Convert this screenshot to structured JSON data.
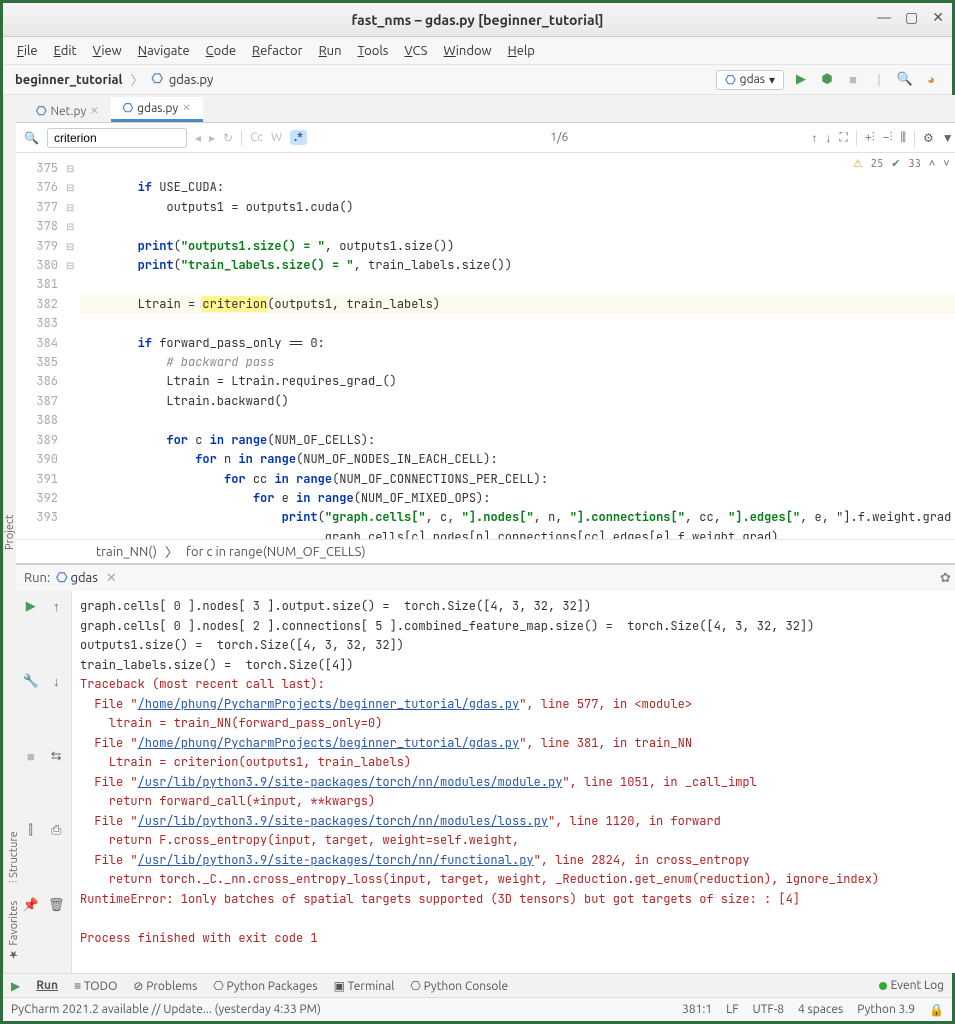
{
  "window": {
    "title": "fast_nms – gdas.py [beginner_tutorial]"
  },
  "menu": [
    "File",
    "Edit",
    "View",
    "Navigate",
    "Code",
    "Refactor",
    "Run",
    "Tools",
    "VCS",
    "Window",
    "Help"
  ],
  "nav": {
    "project": "beginner_tutorial",
    "file": "gdas.py",
    "run_config": "gdas"
  },
  "tabs": [
    {
      "label": "Net.py",
      "active": false
    },
    {
      "label": "gdas.py",
      "active": true
    }
  ],
  "find": {
    "query": "criterion",
    "count": "1/6"
  },
  "inspection": {
    "warnings": "25",
    "oks": "33"
  },
  "gutter_start": 375,
  "gutter_labels": [
    "",
    "375",
    "376",
    "377",
    "378",
    "379",
    "380",
    "381",
    "382",
    "383",
    "384",
    "385",
    "386",
    "387",
    "388",
    "389",
    "390",
    "391",
    "392",
    "393"
  ],
  "code_lines": [
    "",
    "        if USE_CUDA:",
    "            outputs1 = outputs1.cuda()",
    "",
    "        print(\"outputs1.size() = \", outputs1.size())",
    "        print(\"train_labels.size() = \", train_labels.size())",
    "",
    "        Ltrain = criterion(outputs1, train_labels)",
    "",
    "        if forward_pass_only == 0:",
    "            # backward pass",
    "            Ltrain = Ltrain.requires_grad_()",
    "            Ltrain.backward()",
    "",
    "            for c in range(NUM_OF_CELLS):",
    "                for n in range(NUM_OF_NODES_IN_EACH_CELL):",
    "                    for cc in range(NUM_OF_CONNECTIONS_PER_CELL):",
    "                        for e in range(NUM_OF_MIXED_OPS):",
    "                            print(\"graph.cells[\", c, \"].nodes[\", n, \"].connections[\", cc, \"].edges[\", e, \"].f.weight.grad =",
    "                                  graph.cells[c].nodes[n].connections[cc].edges[e].f.weight.grad)"
  ],
  "code_crumb": {
    "a": "train_NN()",
    "b": "for c in range(NUM_OF_CELLS)"
  },
  "run": {
    "title": "gdas"
  },
  "console_lines": [
    {
      "t": "graph.cells[ 0 ].nodes[ 3 ].output.size() =  torch.Size([4, 3, 32, 32])"
    },
    {
      "t": "graph.cells[ 0 ].nodes[ 2 ].connections[ 5 ].combined_feature_map.size() =  torch.Size([4, 3, 32, 32])"
    },
    {
      "t": "outputs1.size() =  torch.Size([4, 3, 32, 32])"
    },
    {
      "t": "train_labels.size() =  torch.Size([4])"
    },
    {
      "err": true,
      "t": "Traceback (most recent call last):"
    },
    {
      "err": true,
      "pre": "  File \"",
      "link": "/home/phung/PycharmProjects/beginner_tutorial/gdas.py",
      "post": "\", line 577, in <module>"
    },
    {
      "err": true,
      "t": "    ltrain = train_NN(forward_pass_only=0)"
    },
    {
      "err": true,
      "pre": "  File \"",
      "link": "/home/phung/PycharmProjects/beginner_tutorial/gdas.py",
      "post": "\", line 381, in train_NN"
    },
    {
      "err": true,
      "t": "    Ltrain = criterion(outputs1, train_labels)"
    },
    {
      "err": true,
      "pre": "  File \"",
      "link": "/usr/lib/python3.9/site-packages/torch/nn/modules/module.py",
      "post": "\", line 1051, in _call_impl"
    },
    {
      "err": true,
      "t": "    return forward_call(*input, **kwargs)"
    },
    {
      "err": true,
      "pre": "  File \"",
      "link": "/usr/lib/python3.9/site-packages/torch/nn/modules/loss.py",
      "post": "\", line 1120, in forward"
    },
    {
      "err": true,
      "t": "    return F.cross_entropy(input, target, weight=self.weight,"
    },
    {
      "err": true,
      "pre": "  File \"",
      "link": "/usr/lib/python3.9/site-packages/torch/nn/functional.py",
      "post": "\", line 2824, in cross_entropy"
    },
    {
      "err": true,
      "t": "    return torch._C._nn.cross_entropy_loss(input, target, weight, _Reduction.get_enum(reduction), ignore_index)"
    },
    {
      "err": true,
      "t": "RuntimeError: 1only batches of spatial targets supported (3D tensors) but got targets of size: : [4]"
    },
    {
      "t": ""
    },
    {
      "err": true,
      "t": "Process finished with exit code 1"
    }
  ],
  "tool_tabs": [
    "Run",
    "TODO",
    "Problems",
    "Python Packages",
    "Terminal",
    "Python Console"
  ],
  "event_log": "Event Log",
  "status_left": "PyCharm 2021.2 available // Update... (yesterday 4:33 PM)",
  "status_right": [
    "381:1",
    "LF",
    "UTF-8",
    "4 spaces",
    "Python 3.9"
  ],
  "side_tabs": [
    "Project"
  ],
  "side_tabs_bottom": [
    "Structure",
    "Favorites"
  ]
}
